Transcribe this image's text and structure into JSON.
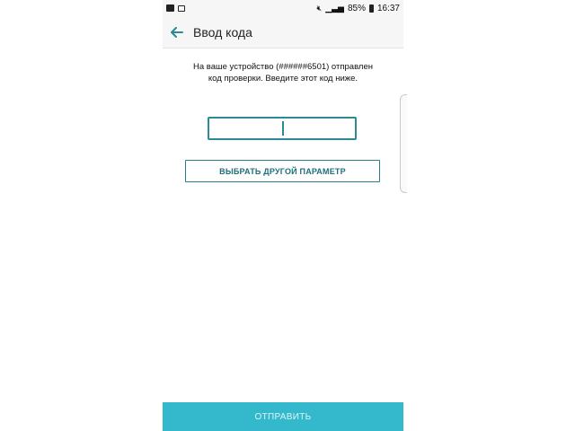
{
  "status_bar": {
    "battery_percent": "85%",
    "time": "16:37",
    "icons_left": [
      "image-icon",
      "notification-icon"
    ],
    "icons_right": [
      "mute-icon",
      "signal-icon",
      "battery-icon"
    ]
  },
  "app_bar": {
    "back_icon": "arrow-left-icon",
    "title": "Ввод кода"
  },
  "content": {
    "message_line1": "На ваше устройство (######6501) отправлен",
    "message_line2": "код проверки. Введите этот код ниже.",
    "code_input": {
      "value": "",
      "placeholder": ""
    },
    "alt_option_label": "ВЫБРАТЬ ДРУГОЙ ПАРАМЕТР"
  },
  "footer": {
    "submit_label": "ОТПРАВИТЬ"
  },
  "colors": {
    "accent": "#2a8a96",
    "submit_bar": "#34b8cc",
    "background": "#ffffff"
  }
}
